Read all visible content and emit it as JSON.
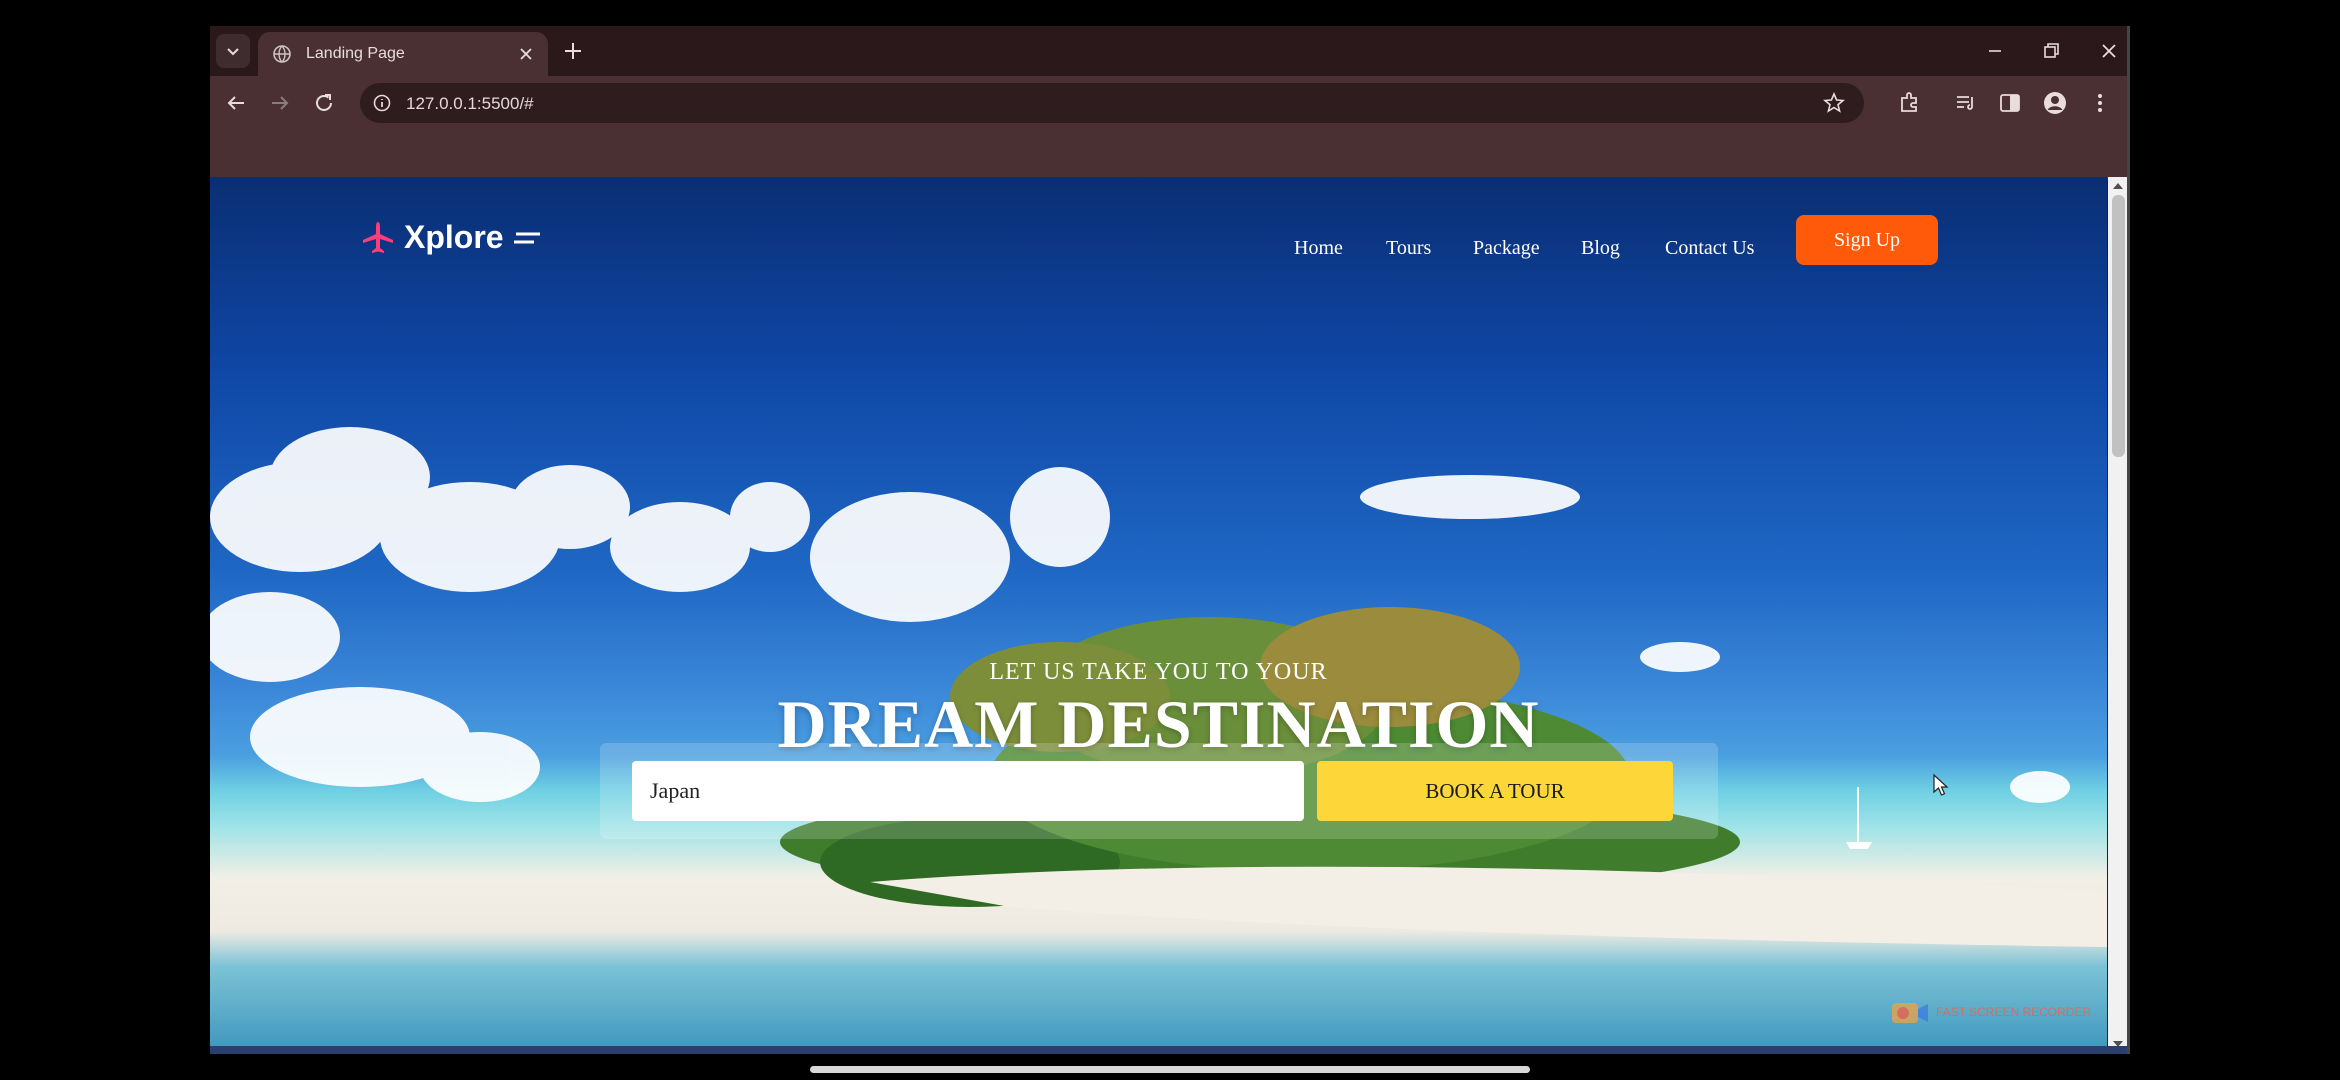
{
  "browser": {
    "tab_title": "Landing Page",
    "url": "127.0.0.1:5500/#"
  },
  "site": {
    "logo_text": "Xplore",
    "nav": [
      "Home",
      "Tours",
      "Package",
      "Blog",
      "Contact Us"
    ],
    "signup_label": "Sign Up",
    "tagline": "LET US TAKE YOU TO YOUR",
    "headline": "DREAM DESTINATION",
    "search_value": "Japan",
    "book_label": "BOOK A TOUR"
  },
  "watermark": "FAST SCREEN RECORDER",
  "colors": {
    "accent_orange": "#ff5a0a",
    "button_yellow": "#fdd73a",
    "logo_pink": "#ff3c78",
    "chrome_dark": "#2a181a",
    "chrome_toolbar": "#4a3033"
  }
}
